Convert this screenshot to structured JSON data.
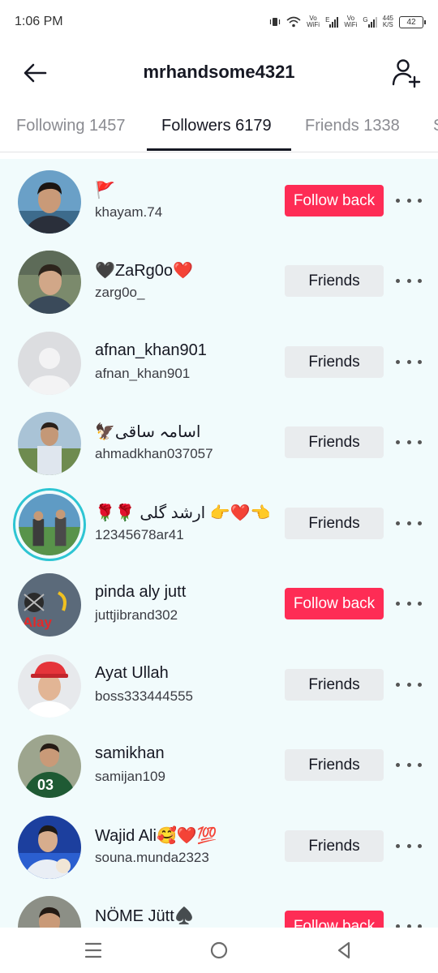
{
  "status": {
    "time": "1:06 PM",
    "vo1": "Vo",
    "wifi1": "WiFi",
    "net1": "E",
    "vo2": "Vo",
    "wifi2": "WiFi",
    "net2": "G",
    "speed_value": "445",
    "speed_unit": "K/S",
    "battery": "42"
  },
  "header": {
    "title": "mrhandsome4321"
  },
  "tabs": [
    {
      "label": "Following 1457"
    },
    {
      "label": "Followers 6179"
    },
    {
      "label": "Friends 1338"
    },
    {
      "label": "S"
    }
  ],
  "followers": [
    {
      "name": "🚩",
      "username": "khayam.74",
      "action": "Follow back"
    },
    {
      "name": "🖤ZaRg0o❤️",
      "username": "zarg0o_",
      "action": "Friends"
    },
    {
      "name": "afnan_khan901",
      "username": "afnan_khan901",
      "action": "Friends"
    },
    {
      "name": "🦅اسامہ ساقی",
      "username": "ahmadkhan037057",
      "action": "Friends"
    },
    {
      "name": "🌹🌹 ارشد گلی 👉❤️👈",
      "username": "12345678ar41",
      "action": "Friends"
    },
    {
      "name": "pinda aly jutt",
      "username": "juttjibrand302",
      "action": "Follow back",
      "avatar_text": "Alay"
    },
    {
      "name": "Ayat Ullah",
      "username": "boss333444555",
      "action": "Friends"
    },
    {
      "name": "samikhan",
      "username": "samijan109",
      "action": "Friends",
      "avatar_text": "03"
    },
    {
      "name": "Wajid Ali🥰❤️💯",
      "username": "souna.munda2323",
      "action": "Friends"
    },
    {
      "name": "NÖME Jütt♠️",
      "username": "",
      "action": "Follow back"
    }
  ],
  "colors": {
    "follow_back": "#fe2c55",
    "friends_bg": "#e9ecee",
    "list_bg": "#f1fbfc",
    "story_ring": "#2ec5d3"
  }
}
